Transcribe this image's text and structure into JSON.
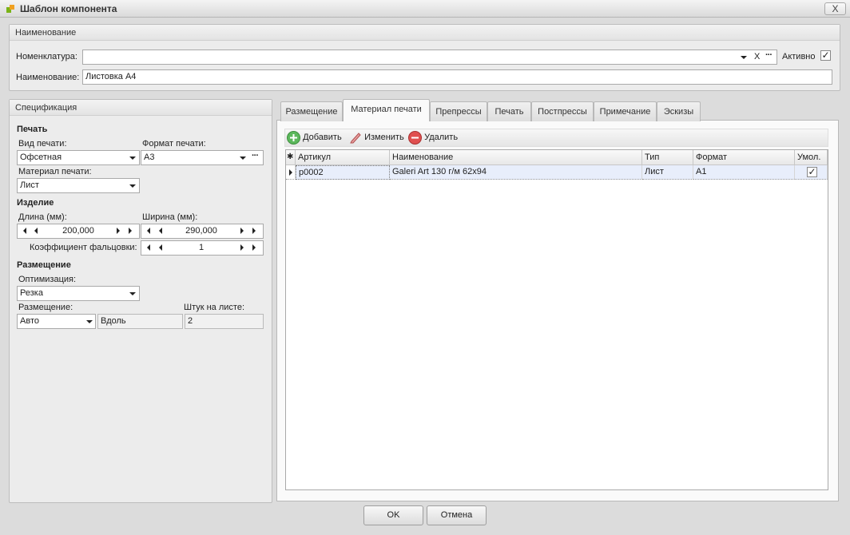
{
  "window": {
    "title": "Шаблон компонента",
    "close_glyph": "X"
  },
  "naming": {
    "header": "Наименование",
    "nomenclature_label": "Номенклатура:",
    "nomenclature_value": "",
    "clear_glyph": "X",
    "ellipsis": "···",
    "active_label": "Активно",
    "active_checked": true,
    "name_label": "Наименование:",
    "name_value": "Листовка А4"
  },
  "spec": {
    "header": "Спецификация",
    "print": {
      "section": "Печать",
      "print_type_label": "Вид печати:",
      "print_type_value": "Офсетная",
      "print_format_label": "Формат печати:",
      "print_format_value": "А3",
      "print_material_label": "Материал печати:",
      "print_material_value": "Лист"
    },
    "product": {
      "section": "Изделие",
      "length_label": "Длина (мм):",
      "length_value": "200,000",
      "width_label": "Ширина (мм):",
      "width_value": "290,000",
      "fold_label": "Коэффициент фальцовки:",
      "fold_value": "1"
    },
    "placement": {
      "section": "Размещение",
      "optimization_label": "Оптимизация:",
      "optimization_value": "Резка",
      "placement_label": "Размещение:",
      "placement_value": "Авто",
      "direction_value": "Вдоль",
      "per_sheet_label": "Штук на листе:",
      "per_sheet_value": "2"
    }
  },
  "tabs": [
    {
      "label": "Размещение",
      "active": false
    },
    {
      "label": "Материал печати",
      "active": true
    },
    {
      "label": "Препрессы",
      "active": false
    },
    {
      "label": "Печать",
      "active": false
    },
    {
      "label": "Постпрессы",
      "active": false
    },
    {
      "label": "Примечание",
      "active": false
    },
    {
      "label": "Эскизы",
      "active": false
    }
  ],
  "toolbar": {
    "add": "Добавить",
    "edit": "Изменить",
    "delete": "Удалить"
  },
  "grid": {
    "columns": [
      "Артикул",
      "Наименование",
      "Тип",
      "Формат",
      "Умол."
    ],
    "rows": [
      {
        "article": "p0002",
        "name": "Galeri Art 130 г/м 62x94",
        "type": "Лист",
        "format": "A1",
        "default": true
      }
    ]
  },
  "buttons": {
    "ok": "OK",
    "cancel": "Отмена"
  },
  "colors": {
    "window_bg": "#dcdcdc",
    "selected_row": "#e8eefb",
    "add_icon": "#5cb85c",
    "delete_icon": "#e05050"
  }
}
